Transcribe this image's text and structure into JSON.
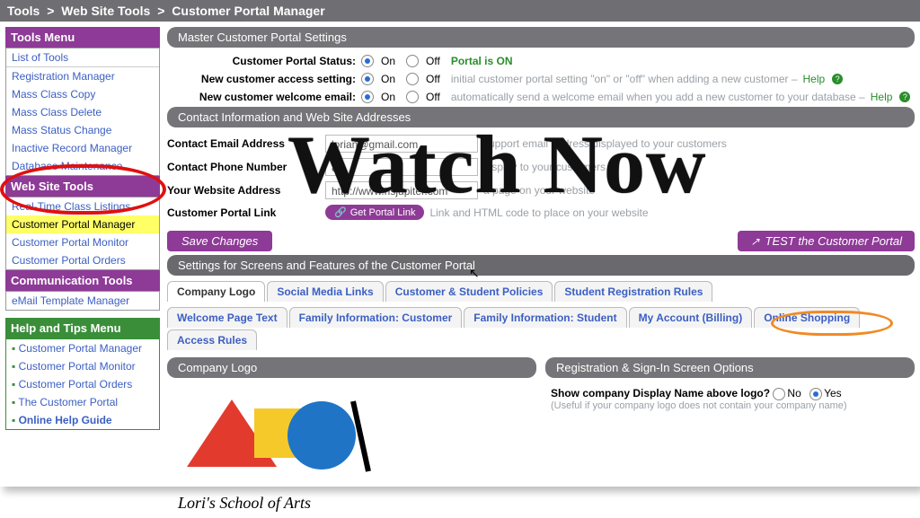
{
  "breadcrumb": {
    "a": "Tools",
    "b": "Web Site Tools",
    "c": "Customer Portal Manager",
    "sep": ">"
  },
  "sidebar": {
    "tools_menu_title": "Tools Menu",
    "tools_top": "List of Tools",
    "tools_items": [
      "Registration Manager",
      "Mass Class Copy",
      "Mass Class Delete",
      "Mass Status Change",
      "Inactive Record Manager",
      "Database Maintenance"
    ],
    "website_tools_title": "Web Site Tools",
    "website_tools_items": [
      "Real-Time Class Listings",
      "Customer Portal Manager",
      "Customer Portal Monitor",
      "Customer Portal Orders"
    ],
    "website_tools_highlight_index": 1,
    "comm_tools_title": "Communication Tools",
    "comm_tools_items": [
      "eMail Template Manager"
    ],
    "help_menu_title": "Help and Tips Menu",
    "help_items": [
      "Customer Portal Manager",
      "Customer Portal Monitor",
      "Customer Portal Orders",
      "The Customer Portal",
      "Online Help Guide"
    ]
  },
  "master": {
    "header": "Master Customer Portal Settings",
    "rows": {
      "status_label": "Customer Portal Status:",
      "access_label": "New customer access setting:",
      "welcome_label": "New customer welcome email:"
    },
    "on": "On",
    "off": "Off",
    "portal_on": "Portal is ON",
    "access_hint": "initial customer portal setting \"on\" or \"off\" when adding a new customer – ",
    "welcome_hint": "automatically send a welcome email when you add a new customer to your database – ",
    "help": "Help",
    "help_glyph": "?"
  },
  "contact": {
    "header": "Contact Information and Web Site Addresses",
    "email_label": "Contact Email Address",
    "email_value": "lorian@gmail.com",
    "email_hint": "support email address displayed to your customers",
    "phone_label": "Contact Phone Number",
    "phone_value": "8",
    "phone_hint": "display to your customers",
    "site_label": "Your Website Address",
    "site_value": "http://www.risjupiter.com",
    "site_hint": "a page on your website",
    "link_label": "Customer Portal Link",
    "get_link_btn": "Get Portal Link",
    "link_hint": "Link and HTML code to place on your website",
    "link_glyph": "🔗"
  },
  "actions": {
    "save": "Save Changes",
    "test": "TEST the Customer Portal",
    "ext_glyph": "↗"
  },
  "settings_header": "Settings for Screens and Features of the Customer Portal",
  "tabs": {
    "row1": [
      "Company Logo",
      "Social Media Links",
      "Customer & Student Policies",
      "Student Registration Rules"
    ],
    "active_row1_index": 0,
    "row2": [
      "Welcome Page Text",
      "Family Information: Customer",
      "Family Information: Student",
      "My Account (Billing)",
      "Online Shopping",
      "Access Rules"
    ],
    "annot_tab_row2_index": 5
  },
  "company_logo_panel": {
    "header": "Company Logo",
    "caption": "Lori's School of Arts"
  },
  "reg_panel": {
    "header": "Registration & Sign-In Screen Options",
    "question": "Show company Display Name above logo?",
    "no": "No",
    "yes": "Yes",
    "hint": "(Useful if your company logo does not contain your company name)"
  },
  "overlay_text": "Watch Now",
  "colors": {
    "purple": "#8e3a97",
    "green": "#3a8e3a",
    "link": "#3b5fc2",
    "highlight": "#ffff66",
    "red": "#e01010",
    "orange": "#f08a24"
  }
}
